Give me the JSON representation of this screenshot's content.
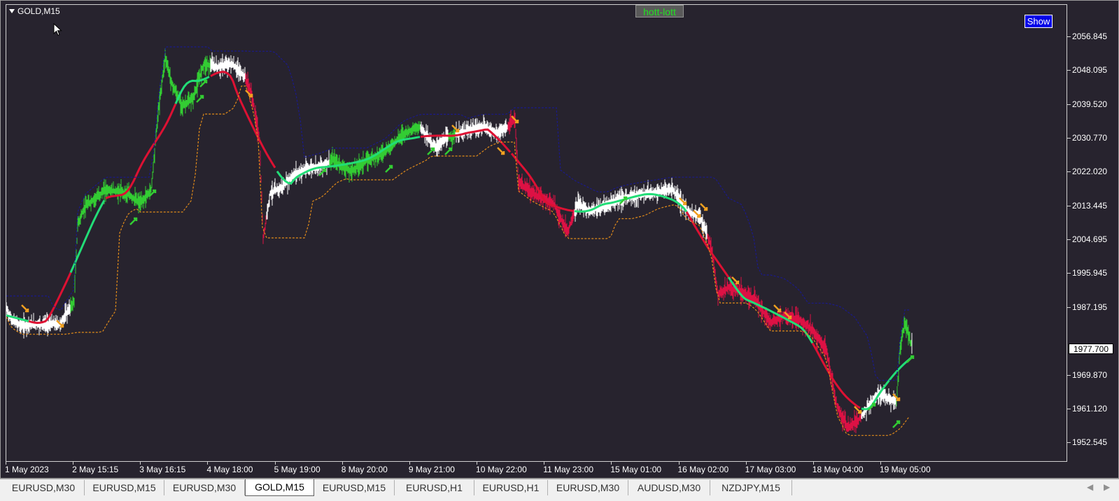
{
  "chart": {
    "symbol": "GOLD,M15",
    "indicator_tag": "hott-lott",
    "show_button": "Show",
    "current_price": "1977.700",
    "price_axis": [
      "2056.845",
      "2048.095",
      "2039.520",
      "2030.770",
      "2022.020",
      "2013.445",
      "2004.695",
      "1995.945",
      "1987.195",
      "1977.700",
      "1969.870",
      "1961.120",
      "1952.545"
    ],
    "time_axis": [
      "1 May 2023",
      "2 May 15:15",
      "3 May 16:15",
      "4 May 18:00",
      "5 May 19:00",
      "8 May 20:00",
      "9 May 21:00",
      "10 May 22:00",
      "11 May 23:00",
      "15 May 01:00",
      "16 May 02:00",
      "17 May 03:00",
      "18 May 04:00",
      "19 May 05:00"
    ],
    "colors": {
      "background": "#27232e",
      "price_up": "#33cc33",
      "price_down": "#dd1144",
      "price_neutral": "#ffffff",
      "ma_up": "#22dd77",
      "ma_down": "#dd1133",
      "upper_band": "#1a1a8a",
      "lower_band": "#e08a1a",
      "arrow_buy": "#33cc33",
      "arrow_sell": "#f0a020"
    }
  },
  "tabs": [
    {
      "label": "EURUSD,M30",
      "active": false
    },
    {
      "label": "EURUSD,M15",
      "active": false
    },
    {
      "label": "EURUSD,M30",
      "active": false
    },
    {
      "label": "GOLD,M15",
      "active": true
    },
    {
      "label": "EURUSD,M15",
      "active": false
    },
    {
      "label": "EURUSD,H1",
      "active": false
    },
    {
      "label": "EURUSD,H1",
      "active": false
    },
    {
      "label": "EURUSD,M30",
      "active": false
    },
    {
      "label": "AUDUSD,M30",
      "active": false
    },
    {
      "label": "NZDJPY,M15",
      "active": false
    }
  ]
}
